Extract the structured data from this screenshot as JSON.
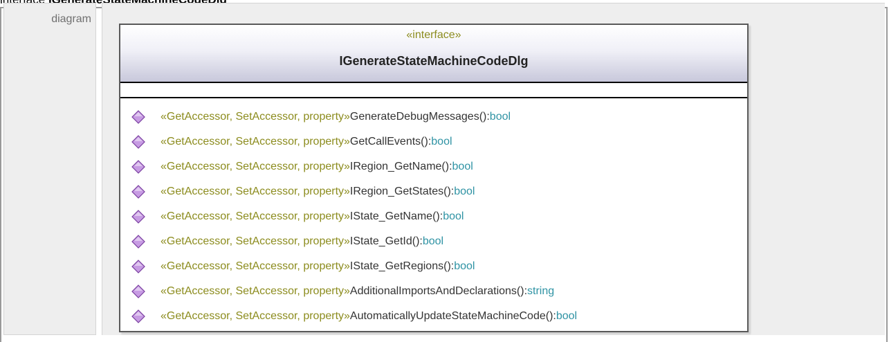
{
  "header": {
    "prefix": "interface",
    "name": "IGenerateStateMachineCodeDlg"
  },
  "label": "diagram",
  "uml_class": {
    "stereotype": "«interface»",
    "name": "IGenerateStateMachineCodeDlg",
    "icon": "purple-diamond-icon",
    "operations": [
      {
        "stereotype": "«GetAccessor, SetAccessor, property»",
        "name": "GenerateDebugMessages",
        "params": "():",
        "type": "bool"
      },
      {
        "stereotype": "«GetAccessor, SetAccessor, property»",
        "name": "GetCallEvents",
        "params": "():",
        "type": "bool"
      },
      {
        "stereotype": "«GetAccessor, SetAccessor, property»",
        "name": "IRegion_GetName",
        "params": "():",
        "type": "bool"
      },
      {
        "stereotype": "«GetAccessor, SetAccessor, property»",
        "name": "IRegion_GetStates",
        "params": "():",
        "type": "bool"
      },
      {
        "stereotype": "«GetAccessor, SetAccessor, property»",
        "name": "IState_GetName",
        "params": "():",
        "type": "bool"
      },
      {
        "stereotype": "«GetAccessor, SetAccessor, property»",
        "name": "IState_GetId",
        "params": "():",
        "type": "bool"
      },
      {
        "stereotype": "«GetAccessor, SetAccessor, property»",
        "name": "IState_GetRegions",
        "params": "():",
        "type": "bool"
      },
      {
        "stereotype": "«GetAccessor, SetAccessor, property»",
        "name": "AdditionalImportsAndDeclarations",
        "params": "():",
        "type": "string"
      },
      {
        "stereotype": "«GetAccessor, SetAccessor, property»",
        "name": "AutomaticallyUpdateStateMachineCode",
        "params": "():",
        "type": "bool"
      }
    ]
  },
  "colors": {
    "stereotype": "#8c8c1e",
    "type": "#2f93a4",
    "icon_fill": "#c79be3",
    "icon_stroke": "#7a3fa0"
  }
}
